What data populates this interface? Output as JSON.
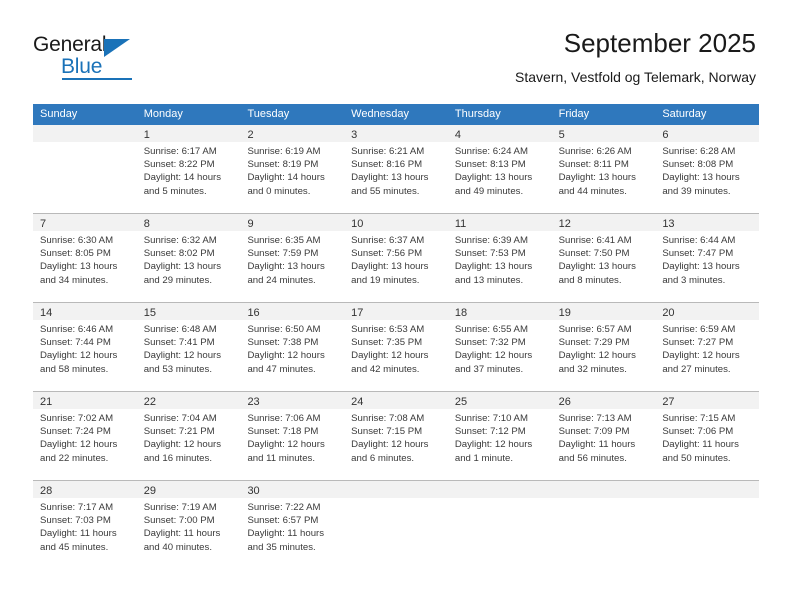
{
  "brand": {
    "name_top": "General",
    "name_bottom": "Blue",
    "color": "#1a72b8"
  },
  "header": {
    "title": "September 2025",
    "subtitle": "Stavern, Vestfold og Telemark, Norway"
  },
  "theme": {
    "header_row_bg": "#2f78bd",
    "date_bar_bg": "#f2f2f2",
    "grid_line": "#b9b9b9",
    "text": "#3a3a3a"
  },
  "weekdays": [
    "Sunday",
    "Monday",
    "Tuesday",
    "Wednesday",
    "Thursday",
    "Friday",
    "Saturday"
  ],
  "weeks": [
    [
      {
        "blank": true
      },
      {
        "day": "1",
        "sunrise": "Sunrise: 6:17 AM",
        "sunset": "Sunset: 8:22 PM",
        "daylight1": "Daylight: 14 hours",
        "daylight2": "and 5 minutes."
      },
      {
        "day": "2",
        "sunrise": "Sunrise: 6:19 AM",
        "sunset": "Sunset: 8:19 PM",
        "daylight1": "Daylight: 14 hours",
        "daylight2": "and 0 minutes."
      },
      {
        "day": "3",
        "sunrise": "Sunrise: 6:21 AM",
        "sunset": "Sunset: 8:16 PM",
        "daylight1": "Daylight: 13 hours",
        "daylight2": "and 55 minutes."
      },
      {
        "day": "4",
        "sunrise": "Sunrise: 6:24 AM",
        "sunset": "Sunset: 8:13 PM",
        "daylight1": "Daylight: 13 hours",
        "daylight2": "and 49 minutes."
      },
      {
        "day": "5",
        "sunrise": "Sunrise: 6:26 AM",
        "sunset": "Sunset: 8:11 PM",
        "daylight1": "Daylight: 13 hours",
        "daylight2": "and 44 minutes."
      },
      {
        "day": "6",
        "sunrise": "Sunrise: 6:28 AM",
        "sunset": "Sunset: 8:08 PM",
        "daylight1": "Daylight: 13 hours",
        "daylight2": "and 39 minutes."
      }
    ],
    [
      {
        "day": "7",
        "sunrise": "Sunrise: 6:30 AM",
        "sunset": "Sunset: 8:05 PM",
        "daylight1": "Daylight: 13 hours",
        "daylight2": "and 34 minutes."
      },
      {
        "day": "8",
        "sunrise": "Sunrise: 6:32 AM",
        "sunset": "Sunset: 8:02 PM",
        "daylight1": "Daylight: 13 hours",
        "daylight2": "and 29 minutes."
      },
      {
        "day": "9",
        "sunrise": "Sunrise: 6:35 AM",
        "sunset": "Sunset: 7:59 PM",
        "daylight1": "Daylight: 13 hours",
        "daylight2": "and 24 minutes."
      },
      {
        "day": "10",
        "sunrise": "Sunrise: 6:37 AM",
        "sunset": "Sunset: 7:56 PM",
        "daylight1": "Daylight: 13 hours",
        "daylight2": "and 19 minutes."
      },
      {
        "day": "11",
        "sunrise": "Sunrise: 6:39 AM",
        "sunset": "Sunset: 7:53 PM",
        "daylight1": "Daylight: 13 hours",
        "daylight2": "and 13 minutes."
      },
      {
        "day": "12",
        "sunrise": "Sunrise: 6:41 AM",
        "sunset": "Sunset: 7:50 PM",
        "daylight1": "Daylight: 13 hours",
        "daylight2": "and 8 minutes."
      },
      {
        "day": "13",
        "sunrise": "Sunrise: 6:44 AM",
        "sunset": "Sunset: 7:47 PM",
        "daylight1": "Daylight: 13 hours",
        "daylight2": "and 3 minutes."
      }
    ],
    [
      {
        "day": "14",
        "sunrise": "Sunrise: 6:46 AM",
        "sunset": "Sunset: 7:44 PM",
        "daylight1": "Daylight: 12 hours",
        "daylight2": "and 58 minutes."
      },
      {
        "day": "15",
        "sunrise": "Sunrise: 6:48 AM",
        "sunset": "Sunset: 7:41 PM",
        "daylight1": "Daylight: 12 hours",
        "daylight2": "and 53 minutes."
      },
      {
        "day": "16",
        "sunrise": "Sunrise: 6:50 AM",
        "sunset": "Sunset: 7:38 PM",
        "daylight1": "Daylight: 12 hours",
        "daylight2": "and 47 minutes."
      },
      {
        "day": "17",
        "sunrise": "Sunrise: 6:53 AM",
        "sunset": "Sunset: 7:35 PM",
        "daylight1": "Daylight: 12 hours",
        "daylight2": "and 42 minutes."
      },
      {
        "day": "18",
        "sunrise": "Sunrise: 6:55 AM",
        "sunset": "Sunset: 7:32 PM",
        "daylight1": "Daylight: 12 hours",
        "daylight2": "and 37 minutes."
      },
      {
        "day": "19",
        "sunrise": "Sunrise: 6:57 AM",
        "sunset": "Sunset: 7:29 PM",
        "daylight1": "Daylight: 12 hours",
        "daylight2": "and 32 minutes."
      },
      {
        "day": "20",
        "sunrise": "Sunrise: 6:59 AM",
        "sunset": "Sunset: 7:27 PM",
        "daylight1": "Daylight: 12 hours",
        "daylight2": "and 27 minutes."
      }
    ],
    [
      {
        "day": "21",
        "sunrise": "Sunrise: 7:02 AM",
        "sunset": "Sunset: 7:24 PM",
        "daylight1": "Daylight: 12 hours",
        "daylight2": "and 22 minutes."
      },
      {
        "day": "22",
        "sunrise": "Sunrise: 7:04 AM",
        "sunset": "Sunset: 7:21 PM",
        "daylight1": "Daylight: 12 hours",
        "daylight2": "and 16 minutes."
      },
      {
        "day": "23",
        "sunrise": "Sunrise: 7:06 AM",
        "sunset": "Sunset: 7:18 PM",
        "daylight1": "Daylight: 12 hours",
        "daylight2": "and 11 minutes."
      },
      {
        "day": "24",
        "sunrise": "Sunrise: 7:08 AM",
        "sunset": "Sunset: 7:15 PM",
        "daylight1": "Daylight: 12 hours",
        "daylight2": "and 6 minutes."
      },
      {
        "day": "25",
        "sunrise": "Sunrise: 7:10 AM",
        "sunset": "Sunset: 7:12 PM",
        "daylight1": "Daylight: 12 hours",
        "daylight2": "and 1 minute."
      },
      {
        "day": "26",
        "sunrise": "Sunrise: 7:13 AM",
        "sunset": "Sunset: 7:09 PM",
        "daylight1": "Daylight: 11 hours",
        "daylight2": "and 56 minutes."
      },
      {
        "day": "27",
        "sunrise": "Sunrise: 7:15 AM",
        "sunset": "Sunset: 7:06 PM",
        "daylight1": "Daylight: 11 hours",
        "daylight2": "and 50 minutes."
      }
    ],
    [
      {
        "day": "28",
        "sunrise": "Sunrise: 7:17 AM",
        "sunset": "Sunset: 7:03 PM",
        "daylight1": "Daylight: 11 hours",
        "daylight2": "and 45 minutes."
      },
      {
        "day": "29",
        "sunrise": "Sunrise: 7:19 AM",
        "sunset": "Sunset: 7:00 PM",
        "daylight1": "Daylight: 11 hours",
        "daylight2": "and 40 minutes."
      },
      {
        "day": "30",
        "sunrise": "Sunrise: 7:22 AM",
        "sunset": "Sunset: 6:57 PM",
        "daylight1": "Daylight: 11 hours",
        "daylight2": "and 35 minutes."
      },
      {
        "blank": true
      },
      {
        "blank": true
      },
      {
        "blank": true
      },
      {
        "blank": true
      }
    ]
  ]
}
